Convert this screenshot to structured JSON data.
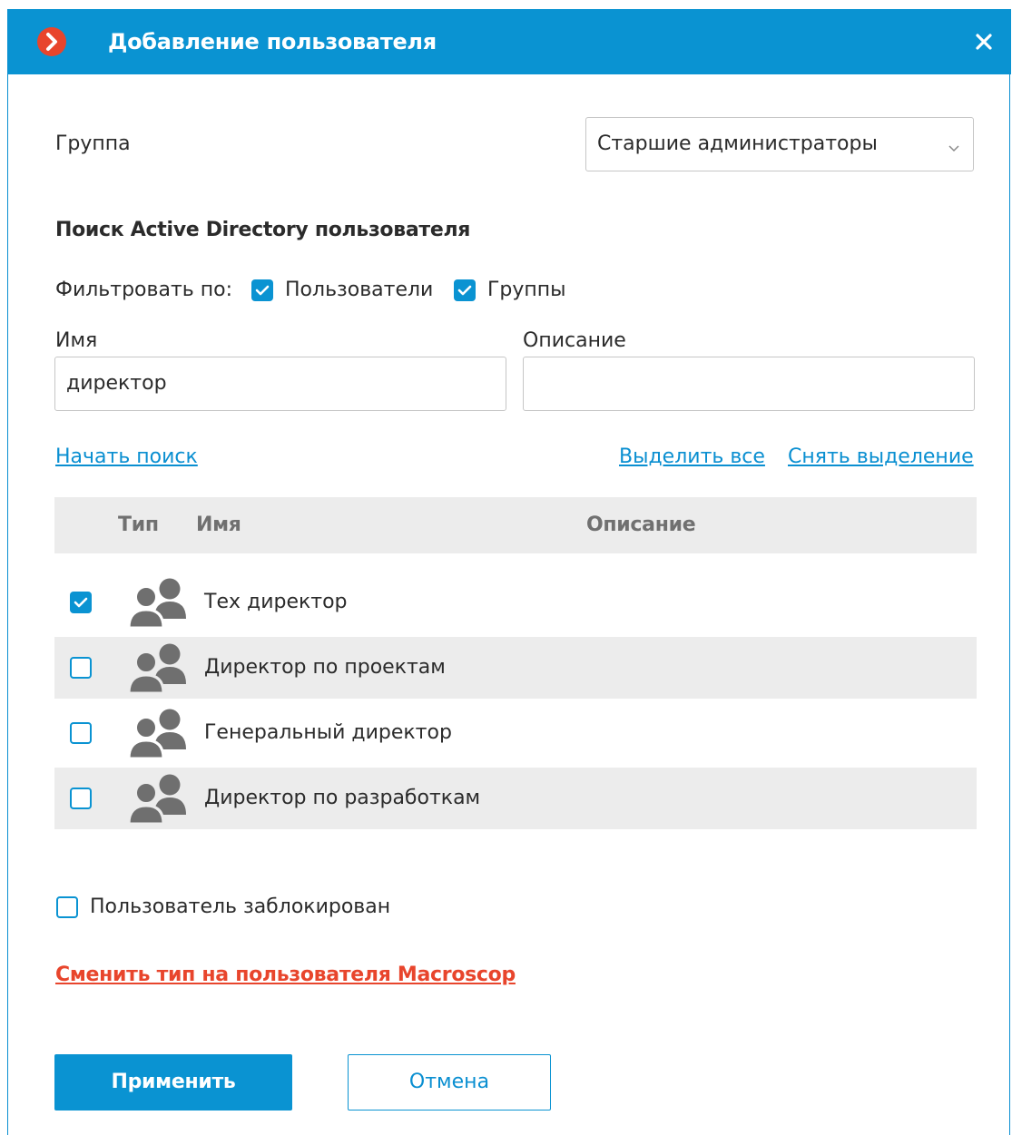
{
  "dialog": {
    "title": "Добавление пользователя"
  },
  "group": {
    "label": "Группа",
    "selected": "Старшие администраторы"
  },
  "search": {
    "section_title": "Поиск Active Directory пользователя",
    "filter_label": "Фильтровать по:",
    "filter_users_label": "Пользователи",
    "filter_users_checked": true,
    "filter_groups_label": "Группы",
    "filter_groups_checked": true,
    "name_label": "Имя",
    "name_value": "директор",
    "description_label": "Описание",
    "description_value": "",
    "start_search": "Начать поиск",
    "select_all": "Выделить все",
    "deselect": "Снять выделение"
  },
  "table": {
    "columns": [
      "Тип",
      "Имя",
      "Описание"
    ],
    "rows": [
      {
        "type_icon": "users-group-icon",
        "name": "Тех директор",
        "description": "",
        "checked": true
      },
      {
        "type_icon": "users-group-icon",
        "name": "Директор по проектам",
        "description": "",
        "checked": false
      },
      {
        "type_icon": "users-group-icon",
        "name": "Генеральный директор",
        "description": "",
        "checked": false
      },
      {
        "type_icon": "users-group-icon",
        "name": "Директор по разработкам",
        "description": "",
        "checked": false
      }
    ]
  },
  "blocked": {
    "label": "Пользователь заблокирован",
    "checked": false
  },
  "change_type_link": "Сменить тип на пользователя Macroscop",
  "buttons": {
    "apply": "Применить",
    "cancel": "Отмена"
  },
  "colors": {
    "accent": "#0a93d2",
    "logo": "#e8452c",
    "link_red": "#e8452c",
    "row_alt": "#ececec",
    "icon_gray": "#6f6f6f"
  }
}
